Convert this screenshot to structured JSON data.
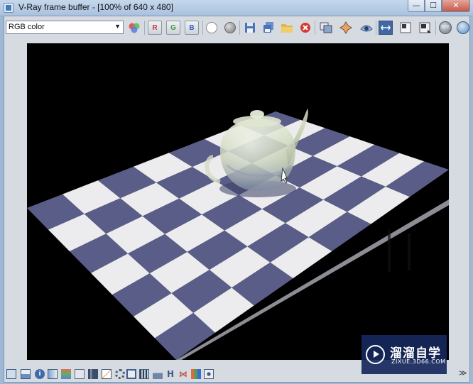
{
  "window": {
    "title": "V-Ray frame buffer - [100% of 640 x 480]",
    "minimize_glyph": "—",
    "maximize_glyph": "☐",
    "close_glyph": "✕"
  },
  "toolbar": {
    "channel_select": {
      "value": "RGB color",
      "arrow": "▼"
    },
    "channel_buttons": {
      "red": "R",
      "green": "G",
      "blue": "B"
    },
    "icons": [
      "channels-color-icon",
      "red-channel-icon",
      "green-channel-icon",
      "blue-channel-icon",
      "white-circle-icon",
      "gray-circle-icon",
      "save-icon",
      "save-all-icon",
      "open-folder-icon",
      "clear-image-icon",
      "duplicate-icon",
      "track-mouse-icon",
      "region-render-icon",
      "show-corrections-icon",
      "lens-effects-icon",
      "stamp-icon",
      "stereo-icon",
      "compare-icon"
    ]
  },
  "bottombar": {
    "icons": [
      "frame-icon",
      "history-icon",
      "info-icon",
      "render-settings-icon",
      "color-icon",
      "pencil-icon",
      "levels-icon",
      "curve-icon",
      "gear-icon",
      "zoom-region-icon",
      "film-icon",
      "histogram-icon",
      "h-icon",
      "exposure-icon",
      "lut-icon",
      "ocio-icon"
    ],
    "expand_glyph": "≫"
  },
  "watermark": {
    "name": "溜溜自学",
    "url": "ZIXUE.3D66.COM"
  },
  "colors": {
    "checker_dark": "#5a5d88",
    "checker_light": "#ececef",
    "viewport_bg": "#000000",
    "titlebar": "#b7cbe2"
  }
}
